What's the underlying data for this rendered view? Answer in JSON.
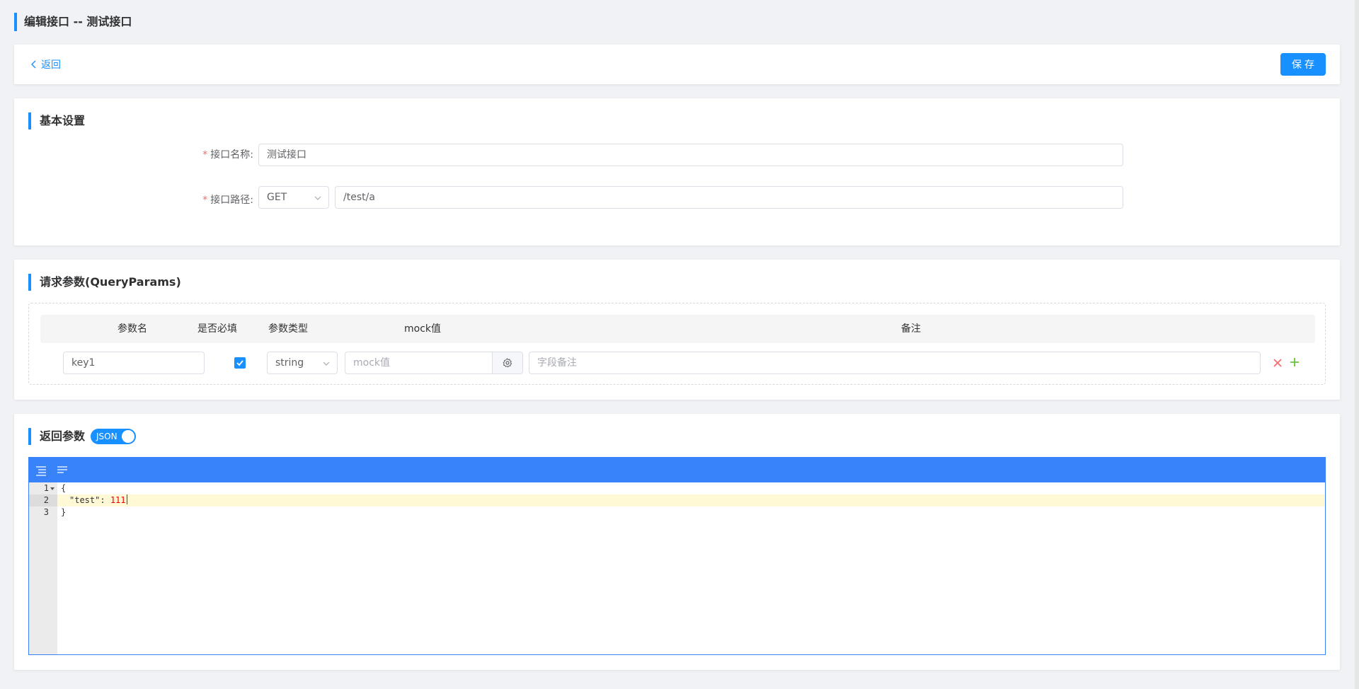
{
  "page_title": "编辑接口 -- 测试接口",
  "toolbar": {
    "back_label": "返回",
    "save_label": "保存"
  },
  "basic": {
    "title": "基本设置",
    "name_label": "接口名称:",
    "name_value": "测试接口",
    "path_label": "接口路径:",
    "method_value": "GET",
    "path_value": "/test/a"
  },
  "query": {
    "title": "请求参数(QueryParams)",
    "headers": [
      "参数名",
      "是否必填",
      "参数类型",
      "mock值",
      "备注"
    ],
    "rows": [
      {
        "name": "key1",
        "required": true,
        "type": "string",
        "mock_placeholder": "mock值",
        "remark_placeholder": "字段备注"
      }
    ]
  },
  "response": {
    "title": "返回参数",
    "toggle_label": "JSON",
    "toggle_on": true,
    "lines": [
      {
        "num": "1",
        "text": "{"
      },
      {
        "num": "2",
        "key": "\"test\"",
        "sep": ": ",
        "value": "111"
      },
      {
        "num": "3",
        "text": "}"
      }
    ]
  },
  "colors": {
    "accent": "#1890ff",
    "editor_blue": "#3883fa",
    "danger": "#f56c6c",
    "success": "#67c23a"
  }
}
